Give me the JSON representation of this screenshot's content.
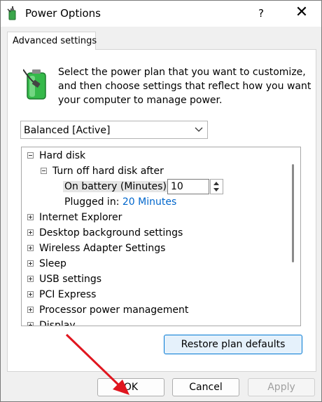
{
  "window": {
    "title": "Power Options",
    "help_label": "?",
    "close_label": "✕"
  },
  "tabs": [
    {
      "label": "Advanced settings"
    }
  ],
  "description": {
    "line1": "Select the power plan that you want to customize,",
    "line2": "and then choose settings that reflect how you want",
    "line3": "your computer to manage power."
  },
  "plan_select": {
    "value": "Balanced [Active]"
  },
  "tree": {
    "hard_disk": "Hard disk",
    "turn_off": "Turn off hard disk after",
    "on_battery_label": "On battery (Minutes):",
    "on_battery_value": "10",
    "plugged_in_label": "Plugged in:",
    "plugged_in_value": "20 Minutes",
    "items": [
      "Internet Explorer",
      "Desktop background settings",
      "Wireless Adapter Settings",
      "Sleep",
      "USB settings",
      "PCI Express",
      "Processor power management",
      "Display"
    ]
  },
  "buttons": {
    "restore": "Restore plan defaults",
    "ok": "OK",
    "cancel": "Cancel",
    "apply": "Apply"
  },
  "colors": {
    "link": "#0066cc",
    "annotation_arrow": "#e0161f",
    "primary_border": "#0078d4"
  },
  "icons": {
    "app": "power-options-icon",
    "battery": "battery-plug-icon"
  }
}
